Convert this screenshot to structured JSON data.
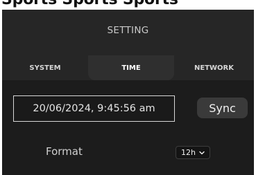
{
  "top_strip": {
    "text": "Sports Sports Sports"
  },
  "header": {
    "title": "SETTING"
  },
  "tabs": [
    {
      "label": "SYSTEM"
    },
    {
      "label": "TIME"
    },
    {
      "label": "NETWORK"
    }
  ],
  "time": {
    "datetime_value": "20/06/2024, 9:45:56 am",
    "sync_label": "Sync",
    "format_label": "Format",
    "format_value": "12h"
  },
  "colors": {
    "panel_bg": "#1c1c1c",
    "header_bg": "#262626",
    "active_tab_bg": "#2f2f2f",
    "button_bg": "#3a3a3a"
  }
}
